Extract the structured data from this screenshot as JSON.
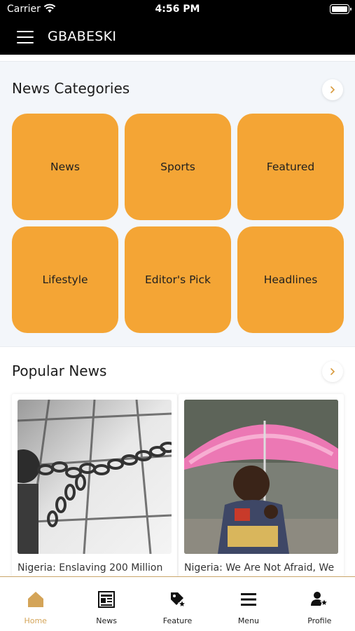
{
  "status_bar": {
    "carrier": "Carrier",
    "time": "4:56 PM"
  },
  "app_bar": {
    "title": "GBABESKI"
  },
  "categories_section": {
    "title": "News Categories",
    "items": [
      {
        "label": "News"
      },
      {
        "label": "Sports"
      },
      {
        "label": "Featured"
      },
      {
        "label": "Lifestyle"
      },
      {
        "label": "Editor's Pick"
      },
      {
        "label": "Headlines"
      }
    ]
  },
  "popular_section": {
    "title": "Popular News",
    "articles": [
      {
        "headline": "Nigeria: Enslaving 200 Million",
        "image": "chains-on-floor"
      },
      {
        "headline": "Nigeria: We Are Not Afraid, We",
        "image": "boy-with-pink-umbrella"
      }
    ]
  },
  "bottom_nav": {
    "items": [
      {
        "label": "Home",
        "icon": "home-icon",
        "active": true
      },
      {
        "label": "News",
        "icon": "newspaper-icon"
      },
      {
        "label": "Feature",
        "icon": "feature-tag-icon"
      },
      {
        "label": "Menu",
        "icon": "menu-icon"
      },
      {
        "label": "Profile",
        "icon": "profile-star-icon"
      }
    ]
  },
  "colors": {
    "accent": "#f4a535",
    "active_nav": "#d4a458",
    "header": "#000000",
    "background": "#f3f6fa"
  }
}
